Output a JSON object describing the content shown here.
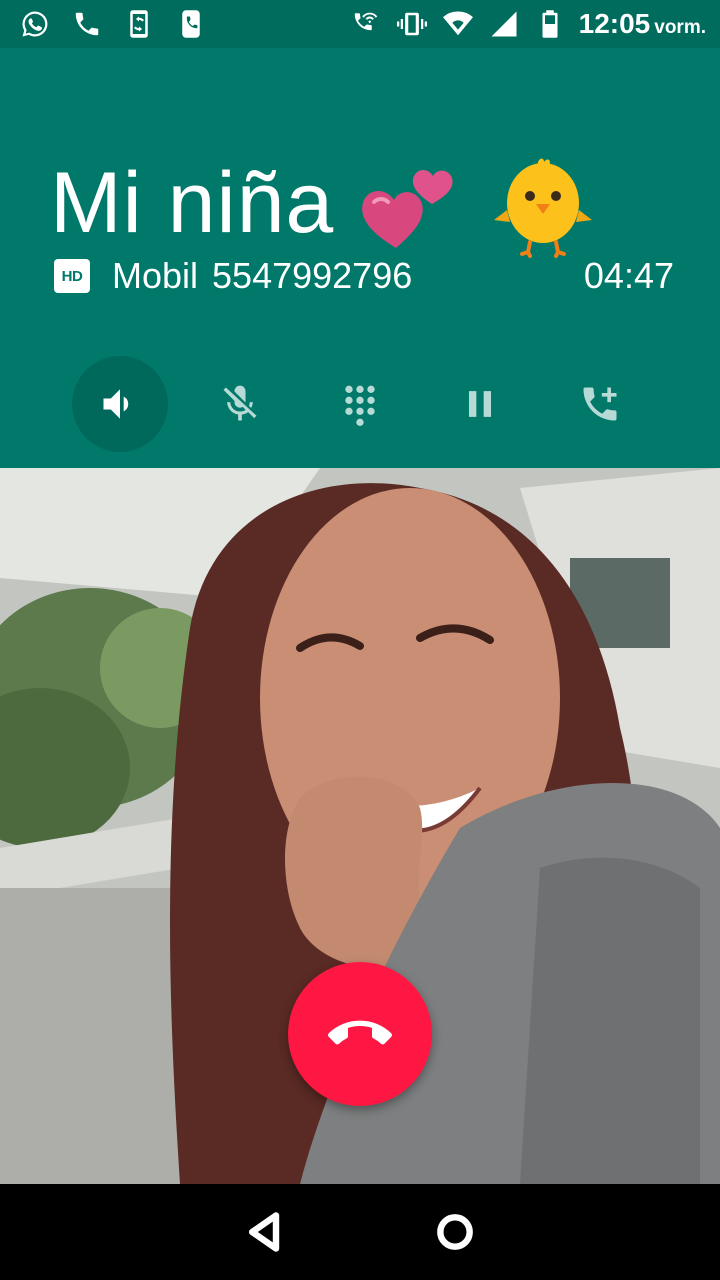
{
  "status_bar": {
    "left_icons": [
      "whatsapp-icon",
      "phone-icon",
      "phone-sync-icon",
      "sim-call-icon"
    ],
    "right_icons": [
      "wifi-call-icon",
      "vibrate-icon",
      "wifi-icon",
      "signal-icon",
      "battery-icon"
    ],
    "time": "12:05",
    "ampm": "vorm."
  },
  "call": {
    "contact_name": "Mi niña",
    "contact_emoji": [
      "two-hearts-icon",
      "chick-icon"
    ],
    "hd_label": "HD",
    "phone_type": "Mobil",
    "phone_number": "5547992796",
    "duration": "04:47"
  },
  "controls": [
    {
      "name": "speaker",
      "icon": "speaker-icon",
      "active": true
    },
    {
      "name": "mute",
      "icon": "mic-off-icon",
      "active": false
    },
    {
      "name": "dialpad",
      "icon": "dialpad-icon",
      "active": false
    },
    {
      "name": "hold",
      "icon": "pause-icon",
      "active": false
    },
    {
      "name": "add-call",
      "icon": "add-call-icon",
      "active": false
    }
  ],
  "end_call": {
    "icon": "end-call-icon"
  },
  "nav": {
    "icons": [
      "back-icon",
      "home-icon"
    ]
  },
  "colors": {
    "header": "#00796b",
    "status_bar": "#006c5d",
    "end_call": "#ff1744"
  }
}
